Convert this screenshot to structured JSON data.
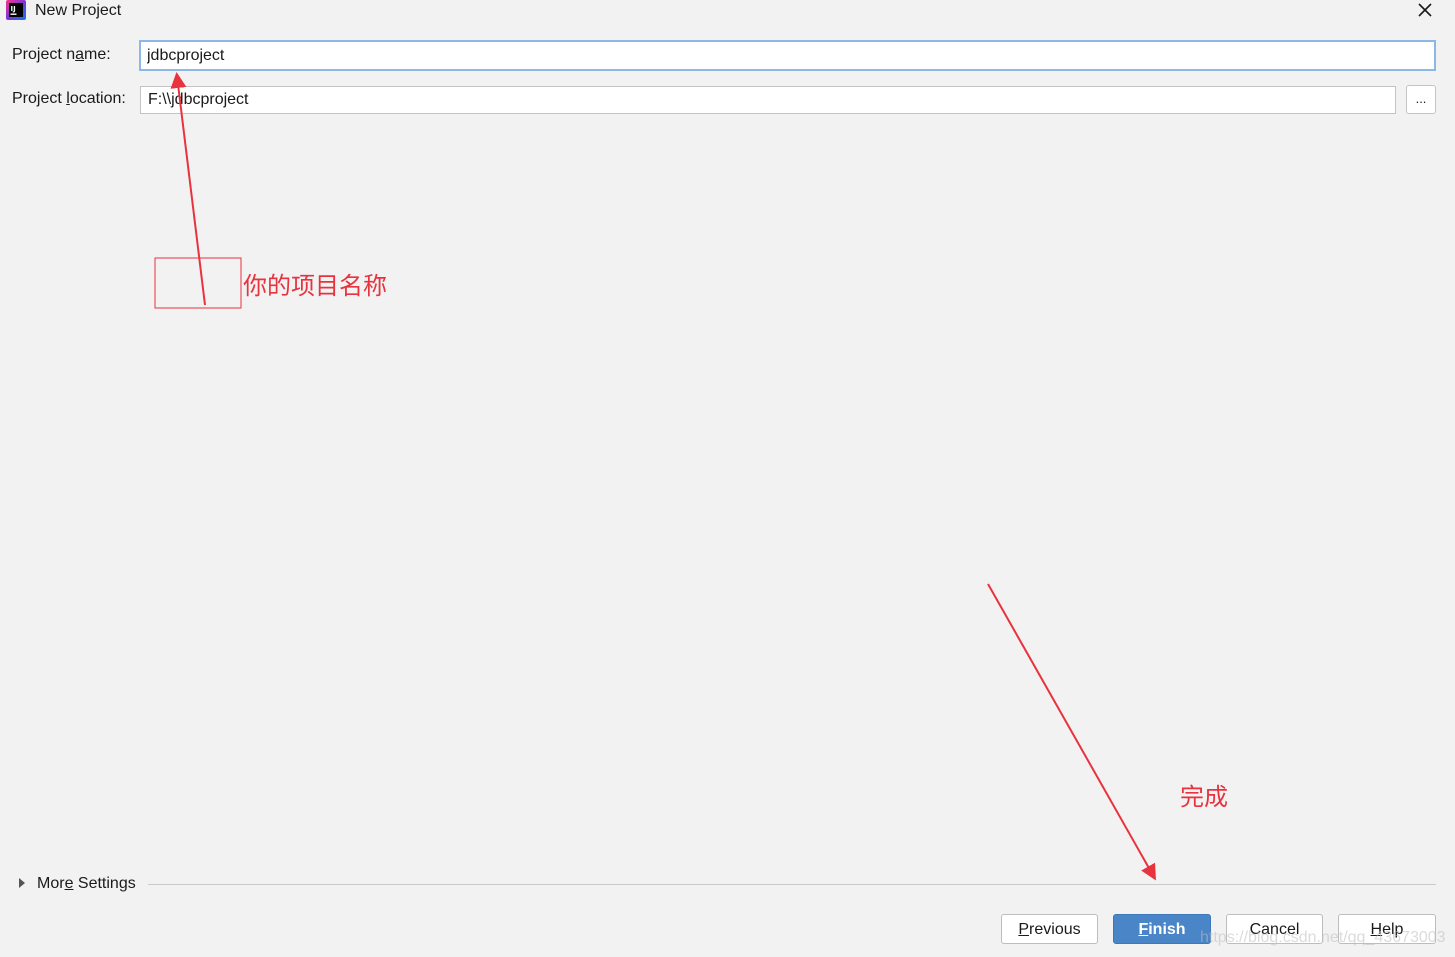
{
  "window": {
    "title": "New Project",
    "app_icon": "intellij-idea-icon",
    "close_icon": "close-icon"
  },
  "form": {
    "project_name": {
      "label_pre": "Project n",
      "label_mnemonic": "a",
      "label_post": "me:",
      "value": "jdbcproject"
    },
    "project_location": {
      "label_pre": "Project ",
      "label_mnemonic": "l",
      "label_post": "ocation:",
      "value": "F:\\\\jdbcproject",
      "browse_label": "..."
    }
  },
  "annotations": {
    "project_name_note": "你的项目名称",
    "finish_note": "完成",
    "color": "#e8333f"
  },
  "more_settings": {
    "label_pre": "Mor",
    "label_mnemonic": "e",
    "label_post": " Settings",
    "icon": "triangle-right-icon"
  },
  "buttons": {
    "previous": {
      "mnemonic": "P",
      "rest": "revious"
    },
    "finish": {
      "mnemonic": "F",
      "rest": "inish"
    },
    "cancel": {
      "label": "Cancel"
    },
    "help": {
      "mnemonic": "H",
      "rest": "elp"
    }
  },
  "watermark": "https://blog.csdn.net/qq_43673003",
  "colors": {
    "background": "#f2f2f2",
    "focus_border": "#8db7e8",
    "primary_button": "#4a86c7",
    "annotation_red": "#e8333f"
  }
}
